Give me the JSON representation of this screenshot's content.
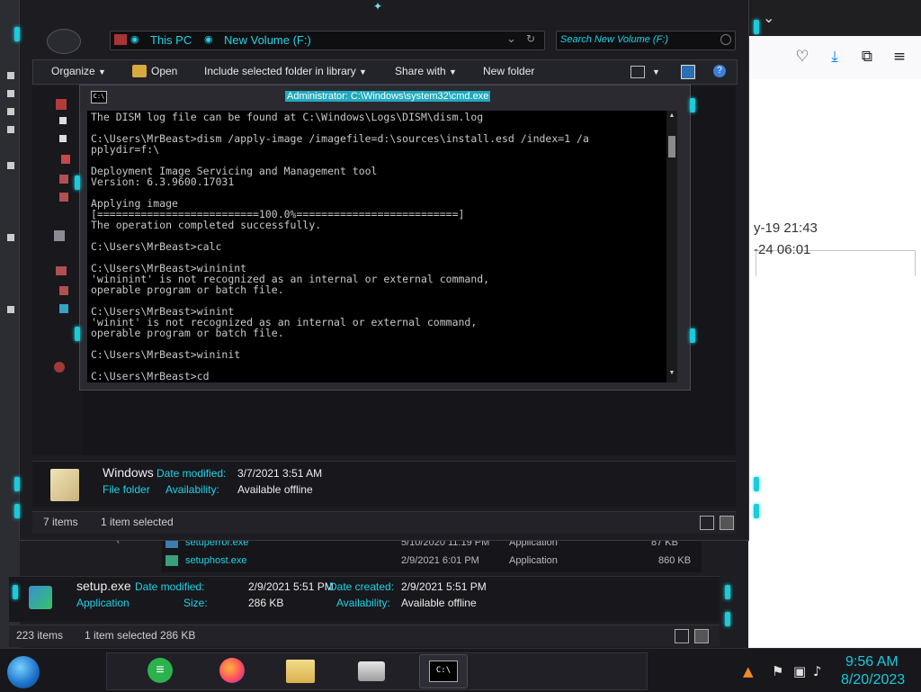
{
  "browser": {
    "icons": [
      "pocket-icon",
      "download-icon",
      "extensions-icon",
      "menu-icon"
    ],
    "rows": [
      "y-19 21:43",
      "-24 06:01"
    ]
  },
  "back_explorer": {
    "files": [
      {
        "name": "setuperror.exe",
        "date": "5/10/2020 11:19 PM",
        "type": "Application",
        "size": "87 KB"
      },
      {
        "name": "setuphost.exe",
        "date": "2/9/2021 6:01 PM",
        "type": "Application",
        "size": "860 KB"
      }
    ],
    "nav_fragment": "New Volume (F",
    "details": {
      "name": "setup.exe",
      "type": "Application",
      "date_modified_label": "Date modified:",
      "date_modified": "2/9/2021 5:51 PM",
      "size_label": "Size:",
      "size": "286 KB",
      "date_created_label": "Date created:",
      "date_created": "2/9/2021 5:51 PM",
      "availability_label": "Availability:",
      "availability": "Available offline"
    },
    "status": {
      "items": "223 items",
      "selected": "1 item selected  286 KB"
    }
  },
  "front_explorer": {
    "breadcrumb": [
      "This PC",
      "New Volume (F:)"
    ],
    "search_placeholder": "Search New Volume (F:)",
    "toolbar": {
      "organize": "Organize",
      "open": "Open",
      "include": "Include selected folder in library",
      "share": "Share with",
      "new_folder": "New folder"
    },
    "details": {
      "name": "Windows",
      "type": "File folder",
      "date_modified_label": "Date modified:",
      "date_modified": "3/7/2021 3:51 AM",
      "availability_label": "Availability:",
      "availability": "Available offline"
    },
    "status": {
      "items": "7 items",
      "selected": "1 item selected"
    }
  },
  "cmd": {
    "title": "Administrator: C:\\Windows\\system32\\cmd.exe",
    "icon_text": "C:\\",
    "lines": [
      "The DISM log file can be found at C:\\Windows\\Logs\\DISM\\dism.log",
      "",
      "C:\\Users\\MrBeast>dism /apply-image /imagefile=d:\\sources\\install.esd /index=1 /a",
      "pplydir=f:\\",
      "",
      "Deployment Image Servicing and Management tool",
      "Version: 6.3.9600.17031",
      "",
      "Applying image",
      "[==========================100.0%==========================]",
      "The operation completed successfully.",
      "",
      "C:\\Users\\MrBeast>calc",
      "",
      "C:\\Users\\MrBeast>wininint",
      "'wininint' is not recognized as an internal or external command,",
      "operable program or batch file.",
      "",
      "C:\\Users\\MrBeast>winint",
      "'winint' is not recognized as an internal or external command,",
      "operable program or batch file.",
      "",
      "C:\\Users\\MrBeast>wininit",
      "",
      "C:\\Users\\MrBeast>cd"
    ]
  },
  "taskbar": {
    "time": "9:56 AM",
    "date": "8/20/2023",
    "apps": [
      "start-orb",
      "feedly-icon",
      "firefox-icon",
      "file-explorer-icon",
      "scanner-icon",
      "cmd-icon"
    ]
  },
  "colors": {
    "accent": "#20d3e6",
    "console_bg": "#000000",
    "frame": "#1c1c21"
  }
}
